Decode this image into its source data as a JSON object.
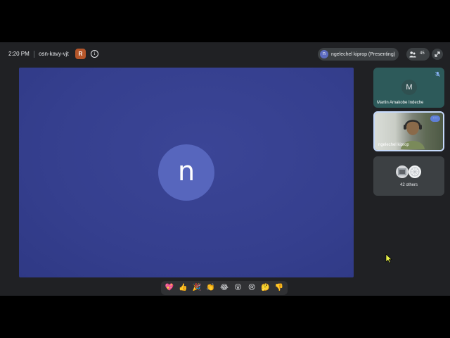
{
  "meeting": {
    "time": "2:20 PM",
    "code": "osn-kavy-vjt",
    "recording_glyph": "R",
    "info_glyph": "i"
  },
  "presenter": {
    "initial": "n",
    "label": "ngelechel kiprop (Presenting)"
  },
  "participants": {
    "count": "45"
  },
  "stage": {
    "avatar_initial": "n",
    "background_color": "#353f8e",
    "avatar_color": "#5766bd"
  },
  "tiles": [
    {
      "initial": "M",
      "name": "Martin Amakobe Indeche",
      "muted": true
    },
    {
      "name": "ngelechel kiprop",
      "video": true
    },
    {
      "name": "42 others"
    }
  ],
  "reactions": [
    "💖",
    "👍",
    "🎉",
    "👏",
    "😂",
    "😮",
    "😢",
    "🤔",
    "👎"
  ],
  "colors": {
    "app_bg": "#202124",
    "chip_bg": "#3c4043",
    "recording": "#b5562a",
    "active_border": "#c6dafc",
    "cursor": "#e6f04a"
  }
}
